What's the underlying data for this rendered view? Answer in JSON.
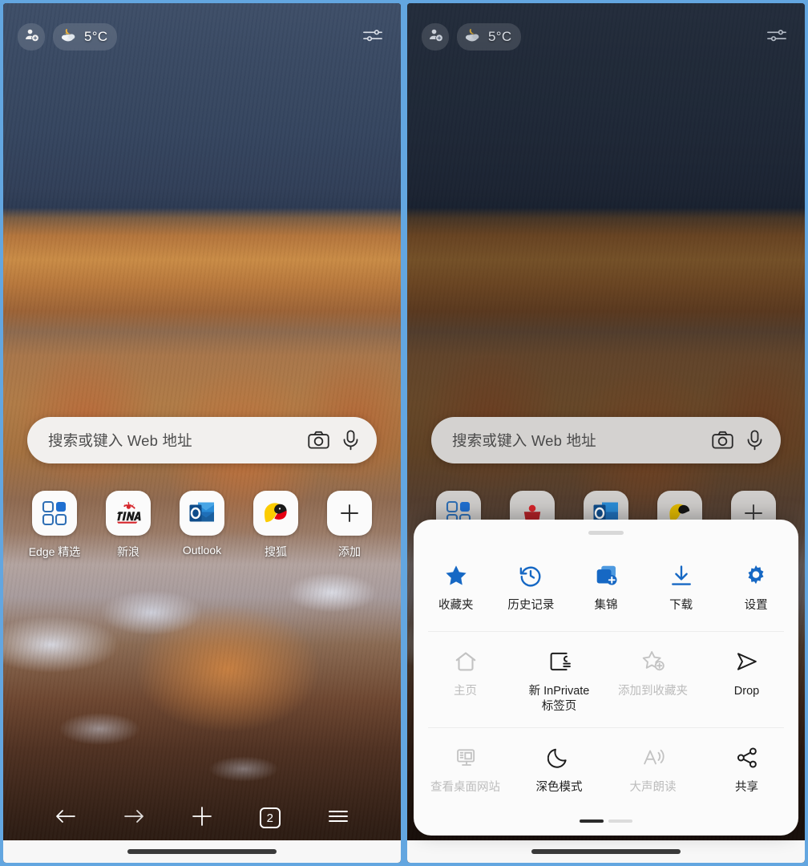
{
  "app": {
    "name": "Microsoft Edge Mobile New Tab",
    "accent_blue": "#0f6cbd",
    "sheet_bg": "#fbfbfb",
    "disabled_color": "#bcbcbc"
  },
  "topbar": {
    "profile_icon": "add-person-icon",
    "weather": {
      "icon": "cloud-moon-icon",
      "temperature": "5°C"
    },
    "tune_icon": "sliders-icon"
  },
  "search": {
    "placeholder": "搜索或键入 Web 地址",
    "camera_icon": "camera-icon",
    "mic_icon": "microphone-icon"
  },
  "shortcuts": [
    {
      "label": "Edge 精选",
      "icon": "edge-collections-icon"
    },
    {
      "label": "新浪",
      "icon": "sina-icon"
    },
    {
      "label": "Outlook",
      "icon": "outlook-icon"
    },
    {
      "label": "搜狐",
      "icon": "sohu-icon"
    },
    {
      "label": "添加",
      "icon": "plus-icon"
    }
  ],
  "bottomnav": {
    "back_icon": "arrow-left-icon",
    "forward_icon": "arrow-right-icon",
    "new_tab_icon": "plus-icon",
    "tab_count": "2",
    "menu_icon": "hamburger-icon"
  },
  "menu": {
    "grabber": "drag-handle",
    "row1": [
      {
        "label": "收藏夹",
        "icon": "star-filled-icon",
        "state": "enabled"
      },
      {
        "label": "历史记录",
        "icon": "history-clock-icon",
        "state": "enabled"
      },
      {
        "label": "集锦",
        "icon": "collections-stack-icon",
        "state": "enabled"
      },
      {
        "label": "下载",
        "icon": "download-arrow-icon",
        "state": "enabled"
      },
      {
        "label": "设置",
        "icon": "gear-icon",
        "state": "enabled"
      }
    ],
    "row2": [
      {
        "label": "主页",
        "icon": "home-icon",
        "state": "disabled"
      },
      {
        "label": "新 InPrivate\n标签页",
        "icon": "inprivate-tab-icon",
        "state": "enabled"
      },
      {
        "label": "添加到收藏夹",
        "icon": "star-plus-icon",
        "state": "disabled"
      },
      {
        "label": "Drop",
        "icon": "drop-send-icon",
        "state": "enabled"
      }
    ],
    "row3": [
      {
        "label": "查看桌面网站",
        "icon": "desktop-monitor-icon",
        "state": "disabled"
      },
      {
        "label": "深色模式",
        "icon": "moon-icon",
        "state": "enabled"
      },
      {
        "label": "大声朗读",
        "icon": "read-aloud-icon",
        "state": "disabled"
      },
      {
        "label": "共享",
        "icon": "share-nodes-icon",
        "state": "enabled"
      }
    ],
    "pager": {
      "pages": 2,
      "active": 1
    }
  }
}
